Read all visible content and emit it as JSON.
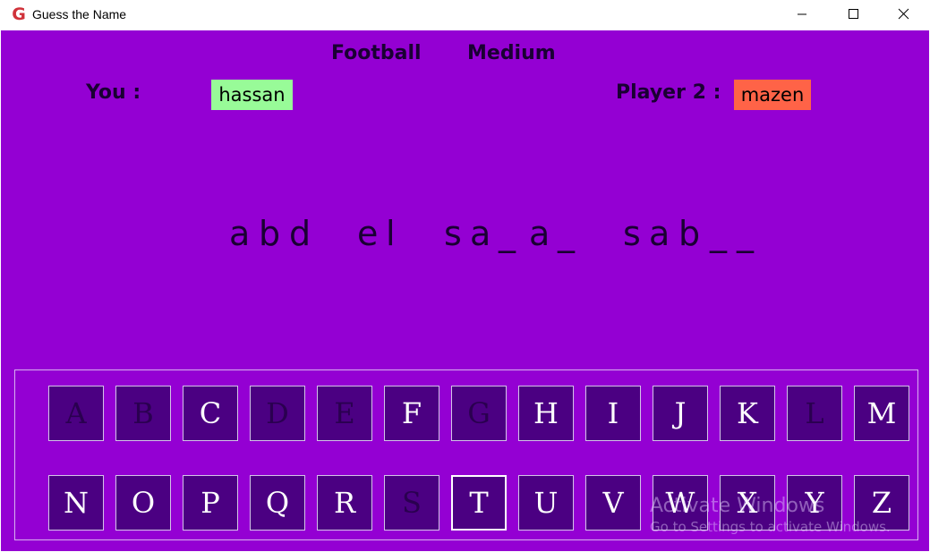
{
  "window": {
    "title": "Guess the Name",
    "icon_letter": "G",
    "buttons": [
      "minimize",
      "maximize",
      "close"
    ]
  },
  "game": {
    "category": "Football",
    "difficulty": "Medium",
    "you_label": "You :",
    "you_name": "hassan",
    "player2_label": "Player 2 :",
    "player2_name": "mazen",
    "word_chars": [
      "a",
      "b",
      "d",
      "e",
      "l",
      "s",
      "a",
      "_",
      "a",
      "_",
      "s",
      "a",
      "b",
      "_",
      "_"
    ]
  },
  "keyboard": {
    "row1": [
      "A",
      "B",
      "C",
      "D",
      "E",
      "F",
      "G",
      "H",
      "I",
      "J",
      "K",
      "L",
      "M"
    ],
    "row2": [
      "N",
      "O",
      "P",
      "Q",
      "R",
      "S",
      "T",
      "U",
      "V",
      "W",
      "X",
      "Y",
      "Z"
    ],
    "used": [
      "A",
      "B",
      "D",
      "E",
      "G",
      "L",
      "S"
    ],
    "active": "T"
  },
  "watermark": {
    "line1": "Activate Windows",
    "line2": "Go to Settings to activate Windows."
  },
  "colors": {
    "background": "#9400d3",
    "key_bg": "#4b0082",
    "you_box": "#98fb98",
    "player2_box": "#ff6347",
    "used_letter": "#2a0050"
  }
}
